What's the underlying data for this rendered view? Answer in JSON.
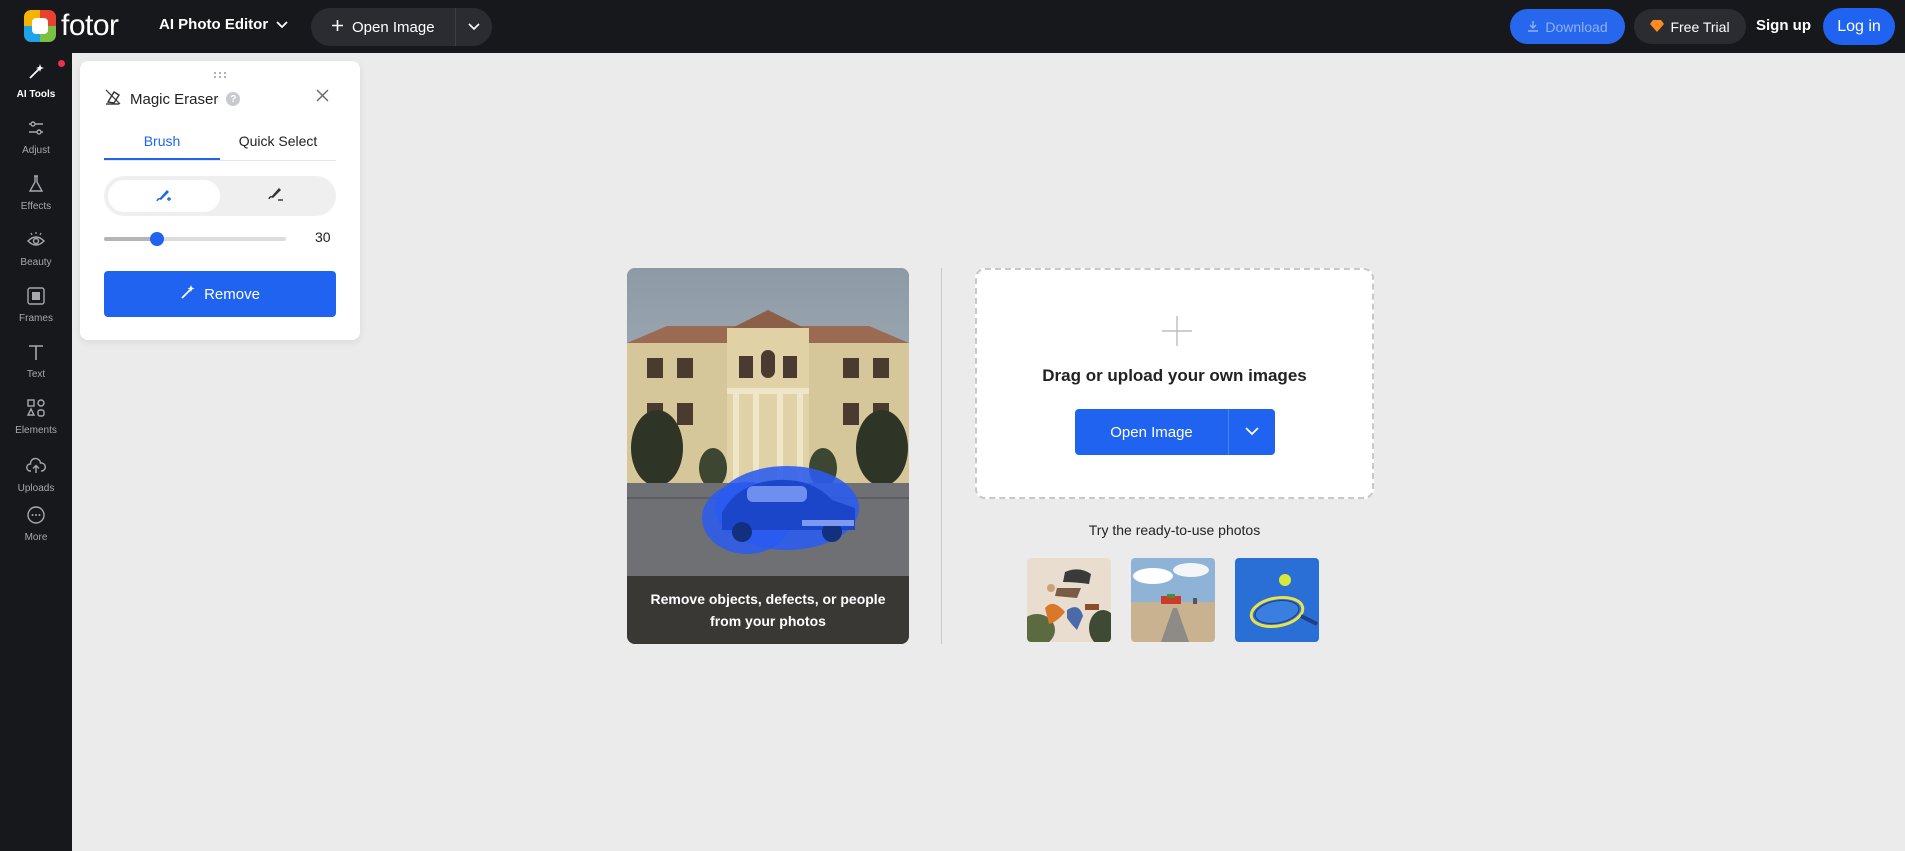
{
  "topbar": {
    "logo_text": "fotor",
    "app_menu": "AI Photo Editor",
    "open_image": "Open Image",
    "download": "Download",
    "free_trial": "Free Trial",
    "sign_up": "Sign up",
    "log_in": "Log in"
  },
  "sidebar": {
    "items": [
      {
        "label": "AI Tools",
        "icon": "magic-wand-icon",
        "active": true
      },
      {
        "label": "Adjust",
        "icon": "sliders-icon"
      },
      {
        "label": "Effects",
        "icon": "flask-icon"
      },
      {
        "label": "Beauty",
        "icon": "eye-icon"
      },
      {
        "label": "Frames",
        "icon": "frame-icon"
      },
      {
        "label": "Text",
        "icon": "text-icon"
      },
      {
        "label": "Elements",
        "icon": "shapes-icon"
      },
      {
        "label": "Uploads",
        "icon": "cloud-upload-icon"
      },
      {
        "label": "More",
        "icon": "more-dots-icon"
      }
    ]
  },
  "panel": {
    "title": "Magic Eraser",
    "help": "?",
    "tabs": [
      "Brush",
      "Quick Select"
    ],
    "active_tab": "Brush",
    "brush_size": "30",
    "brush_size_fraction": 0.29,
    "remove_label": "Remove"
  },
  "demo": {
    "caption": "Remove objects, defects, or people from your photos"
  },
  "upload": {
    "prompt": "Drag or upload your own images",
    "button": "Open Image",
    "try_text": "Try the ready-to-use photos"
  },
  "colors": {
    "accent": "#1f63f0",
    "topbar_bg": "#17181c",
    "canvas_bg": "#ebebeb"
  }
}
